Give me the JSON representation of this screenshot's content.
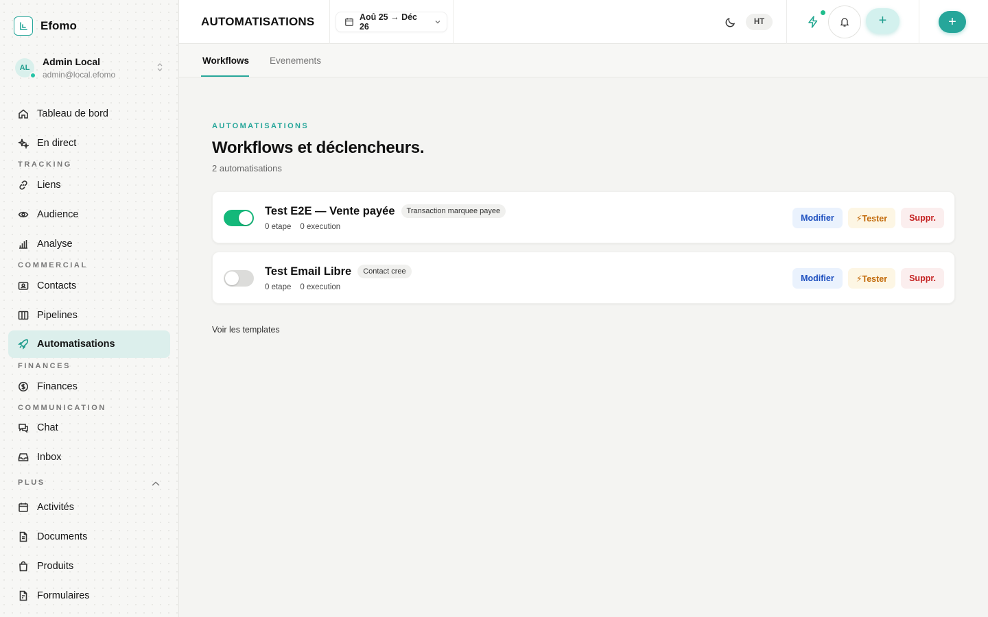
{
  "brand": {
    "name": "Efomo"
  },
  "user": {
    "initials": "AL",
    "name": "Admin Local",
    "email": "admin@local.efomo"
  },
  "sidebar": {
    "items": [
      {
        "label": "Tableau de bord",
        "icon": "home-icon"
      },
      {
        "label": "En direct",
        "icon": "sparkles-icon"
      },
      {
        "label": "Liens",
        "icon": "link-icon"
      },
      {
        "label": "Audience",
        "icon": "eye-icon"
      },
      {
        "label": "Analyse",
        "icon": "bar-chart-icon"
      },
      {
        "label": "Contacts",
        "icon": "contact-card-icon"
      },
      {
        "label": "Pipelines",
        "icon": "columns-icon"
      },
      {
        "label": "Automatisations",
        "icon": "rocket-icon",
        "active": true
      },
      {
        "label": "Finances",
        "icon": "dollar-circle-icon"
      },
      {
        "label": "Chat",
        "icon": "chat-icon"
      },
      {
        "label": "Inbox",
        "icon": "inbox-icon"
      },
      {
        "label": "Activités",
        "icon": "calendar-icon"
      },
      {
        "label": "Documents",
        "icon": "document-icon"
      },
      {
        "label": "Produits",
        "icon": "shopping-bag-icon"
      },
      {
        "label": "Formulaires",
        "icon": "form-icon"
      }
    ],
    "sections": {
      "tracking": "TRACKING",
      "commercial": "COMMERCIAL",
      "finances": "FINANCES",
      "communication": "COMMUNICATION",
      "plus": "PLUS"
    }
  },
  "header": {
    "title": "AUTOMATISATIONS",
    "date_range": "Aoû 25 → Déc 26",
    "tax_mode": "HT",
    "accent": "#26a69a"
  },
  "tabs": [
    {
      "label": "Workflows",
      "active": true
    },
    {
      "label": "Evenements",
      "active": false
    }
  ],
  "main": {
    "eyebrow": "AUTOMATISATIONS",
    "title": "Workflows et déclencheurs.",
    "count": "2 automatisations",
    "templates_link": "Voir les templates"
  },
  "workflows": [
    {
      "enabled": true,
      "name": "Test E2E — Vente payée",
      "trigger": "Transaction marquee payee",
      "steps": "0 etape",
      "runs": "0 execution"
    },
    {
      "enabled": false,
      "name": "Test Email Libre",
      "trigger": "Contact cree",
      "steps": "0 etape",
      "runs": "0 execution"
    }
  ],
  "actions": {
    "edit": "Modifier",
    "test": "⚡Tester",
    "delete": "Suppr."
  },
  "colors": {
    "toggle_on": "#14b87a",
    "edit": "#1d4fbf",
    "test": "#c26a0a",
    "delete": "#c42222"
  }
}
